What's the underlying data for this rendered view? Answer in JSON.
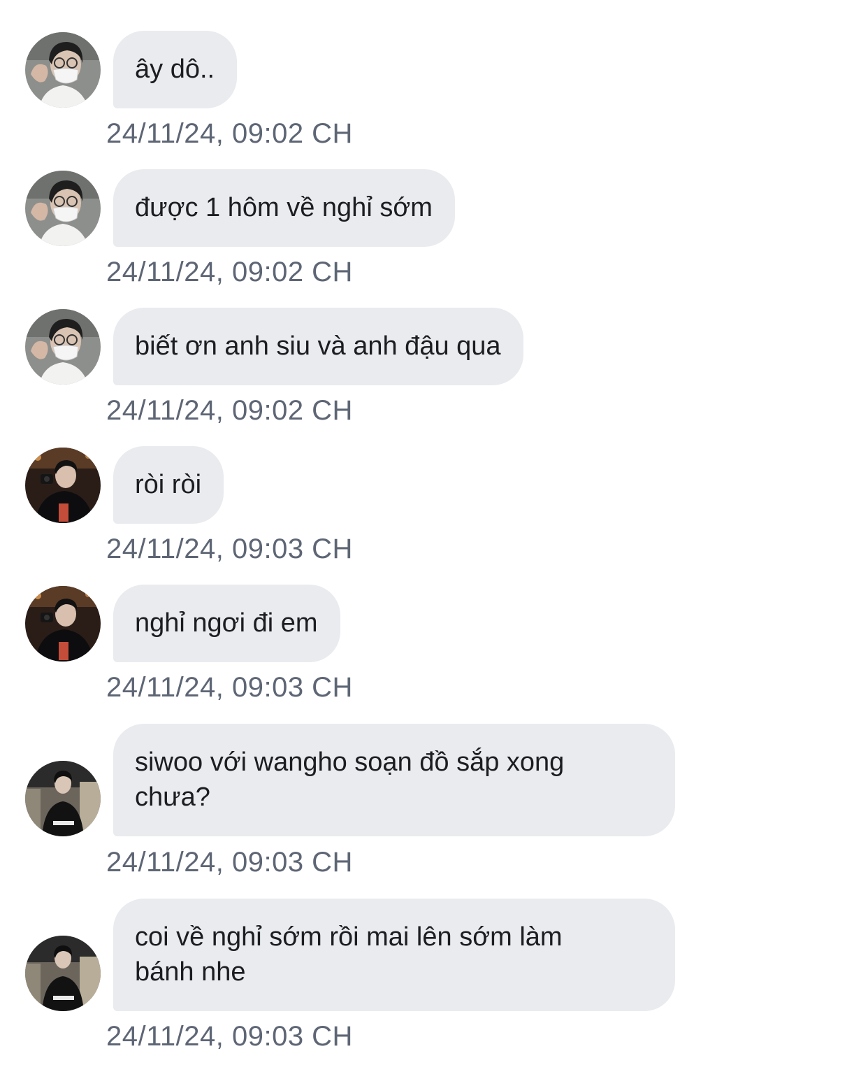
{
  "messages": [
    {
      "text": "ây dô..",
      "time": "24/11/24, 09:02 CH",
      "avatar": "avatar-masked-glasses"
    },
    {
      "text": "được 1 hôm về nghỉ sớm",
      "time": "24/11/24, 09:02 CH",
      "avatar": "avatar-masked-glasses"
    },
    {
      "text": "biết ơn anh siu và anh đậu qua",
      "time": "24/11/24, 09:02 CH",
      "avatar": "avatar-masked-glasses"
    },
    {
      "text": "ròi ròi",
      "time": "24/11/24, 09:03 CH",
      "avatar": "avatar-dark-photo"
    },
    {
      "text": "nghỉ ngơi đi em",
      "time": "24/11/24, 09:03 CH",
      "avatar": "avatar-dark-photo"
    },
    {
      "text": "siwoo với wangho soạn đồ sắp xong\nchưa?",
      "time": "24/11/24, 09:03 CH",
      "avatar": "avatar-seated-black"
    },
    {
      "text": "coi về nghỉ sớm rồi mai lên sớm làm\nbánh nhe",
      "time": "24/11/24, 09:03 CH",
      "avatar": "avatar-seated-black"
    }
  ],
  "colors": {
    "bubble": "#e9ebef",
    "text": "#1c1d20",
    "timestamp": "#5e6675",
    "background": "#ffffff"
  }
}
